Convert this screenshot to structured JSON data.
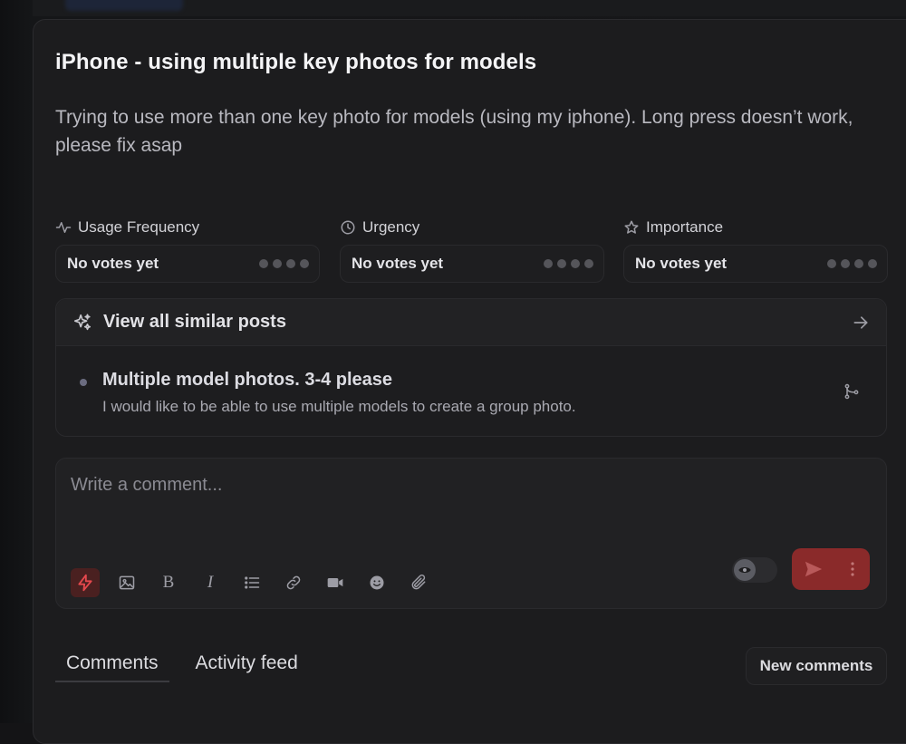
{
  "post": {
    "title": "iPhone - using multiple key photos for models",
    "description": "Trying to use more than one key photo for models (using my iphone). Long press doesn’t work, please fix asap"
  },
  "metrics": [
    {
      "label": "Usage Frequency",
      "icon": "activity-icon",
      "value": "No votes yet",
      "level_filled": 0,
      "level_max": 4
    },
    {
      "label": "Urgency",
      "icon": "clock-icon",
      "value": "No votes yet",
      "level_filled": 0,
      "level_max": 4
    },
    {
      "label": "Importance",
      "icon": "star-icon",
      "value": "No votes yet",
      "level_filled": 0,
      "level_max": 4
    }
  ],
  "similar": {
    "header": "View all similar posts",
    "items": [
      {
        "title": "Multiple model photos. 3-4 please",
        "description": "I would like to be able to use multiple models to create a group photo."
      }
    ]
  },
  "comment": {
    "placeholder": "Write a comment...",
    "value": "",
    "tools": [
      "lightning-icon",
      "image-icon",
      "bold-icon",
      "italic-icon",
      "list-icon",
      "link-icon",
      "video-icon",
      "emoji-icon",
      "paperclip-icon"
    ],
    "bold_glyph": "B",
    "italic_glyph": "I"
  },
  "tabs": [
    {
      "label": "Comments",
      "active": true
    },
    {
      "label": "Activity feed",
      "active": false
    }
  ],
  "new_comments_label": "New comments",
  "colors": {
    "accent": "#e5484d",
    "send_button": "#8a2a2a",
    "panel": "#1c1c1e",
    "text_primary": "#f4f4f6",
    "text_secondary": "#b9b9c0"
  }
}
